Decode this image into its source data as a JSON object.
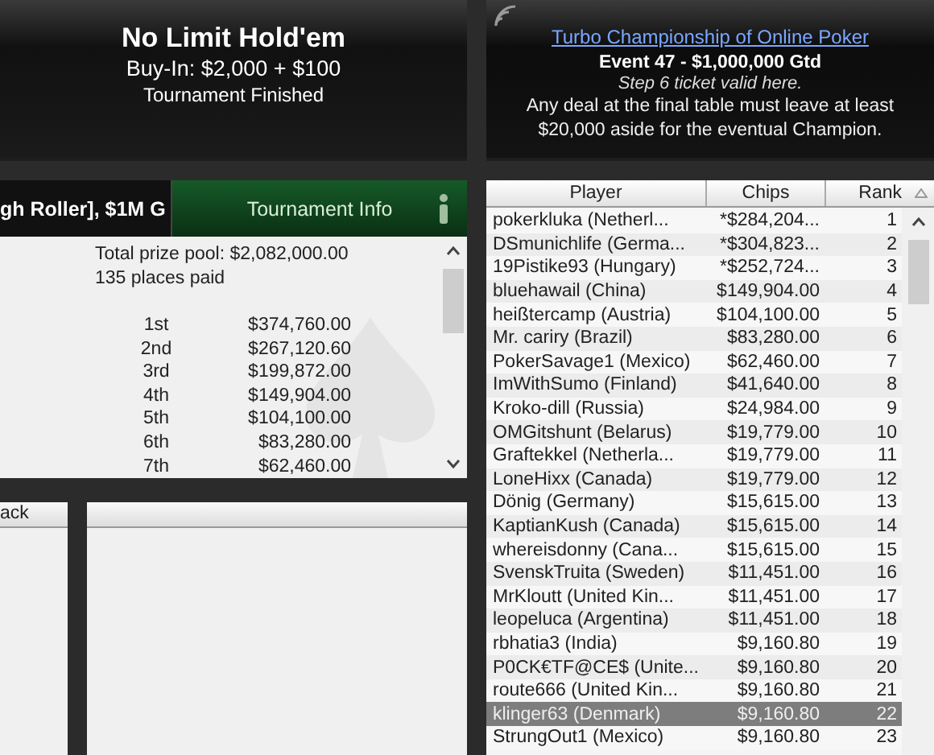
{
  "header": {
    "title": "No Limit Hold'em",
    "buy_in": "Buy-In: $2,000 + $100",
    "status": "Tournament Finished"
  },
  "event": {
    "link": "Turbo Championship of Online Poker",
    "subtitle": "Event 47 - $1,000,000 Gtd",
    "note": "Step 6 ticket valid here.",
    "message": "Any deal at the final table must leave at least $20,000 aside for the eventual Champion."
  },
  "tabs": [
    {
      "label": "gh Roller], $1M G",
      "selected": false
    },
    {
      "label": "Tournament Info",
      "selected": true
    }
  ],
  "prize": {
    "total": "Total prize pool: $2,082,000.00",
    "places": "135 places paid",
    "payouts": [
      {
        "place": "1st",
        "amount": "$374,760.00"
      },
      {
        "place": "2nd",
        "amount": "$267,120.60"
      },
      {
        "place": "3rd",
        "amount": "$199,872.00"
      },
      {
        "place": "4th",
        "amount": "$149,904.00"
      },
      {
        "place": "5th",
        "amount": "$104,100.00"
      },
      {
        "place": "6th",
        "amount": "$83,280.00"
      },
      {
        "place": "7th",
        "amount": "$62,460.00"
      }
    ]
  },
  "lower_left": {
    "header": "ack"
  },
  "players": {
    "columns": [
      "Player",
      "Chips",
      "Rank"
    ],
    "rows": [
      {
        "player": "pokerkluka (Netherl...",
        "chips": "*$284,204...",
        "rank": "1",
        "selected": false
      },
      {
        "player": "DSmunichlife (Germa...",
        "chips": "*$304,823...",
        "rank": "2",
        "selected": false
      },
      {
        "player": "19Pistike93 (Hungary)",
        "chips": "*$252,724...",
        "rank": "3",
        "selected": false
      },
      {
        "player": "bluehawail (China)",
        "chips": "$149,904.00",
        "rank": "4",
        "selected": false
      },
      {
        "player": "heißtercamp (Austria)",
        "chips": "$104,100.00",
        "rank": "5",
        "selected": false
      },
      {
        "player": "Mr. cariry (Brazil)",
        "chips": "$83,280.00",
        "rank": "6",
        "selected": false
      },
      {
        "player": "PokerSavage1 (Mexico)",
        "chips": "$62,460.00",
        "rank": "7",
        "selected": false
      },
      {
        "player": "ImWithSumo (Finland)",
        "chips": "$41,640.00",
        "rank": "8",
        "selected": false
      },
      {
        "player": "Kroko-dill (Russia)",
        "chips": "$24,984.00",
        "rank": "9",
        "selected": false
      },
      {
        "player": "OMGitshunt (Belarus)",
        "chips": "$19,779.00",
        "rank": "10",
        "selected": false
      },
      {
        "player": "Graftekkel (Netherla...",
        "chips": "$19,779.00",
        "rank": "11",
        "selected": false
      },
      {
        "player": "LoneHixx (Canada)",
        "chips": "$19,779.00",
        "rank": "12",
        "selected": false
      },
      {
        "player": "Dönig (Germany)",
        "chips": "$15,615.00",
        "rank": "13",
        "selected": false
      },
      {
        "player": "KaptianKush (Canada)",
        "chips": "$15,615.00",
        "rank": "14",
        "selected": false
      },
      {
        "player": "whereisdonny (Cana...",
        "chips": "$15,615.00",
        "rank": "15",
        "selected": false
      },
      {
        "player": "SvenskTruita (Sweden)",
        "chips": "$11,451.00",
        "rank": "16",
        "selected": false
      },
      {
        "player": "MrKloutt (United Kin...",
        "chips": "$11,451.00",
        "rank": "17",
        "selected": false
      },
      {
        "player": "leopeluca (Argentina)",
        "chips": "$11,451.00",
        "rank": "18",
        "selected": false
      },
      {
        "player": "rbhatia3 (India)",
        "chips": "$9,160.80",
        "rank": "19",
        "selected": false
      },
      {
        "player": "P0CK€TF@CE$ (Unite...",
        "chips": "$9,160.80",
        "rank": "20",
        "selected": false
      },
      {
        "player": "route666 (United Kin...",
        "chips": "$9,160.80",
        "rank": "21",
        "selected": false
      },
      {
        "player": "klinger63 (Denmark)",
        "chips": "$9,160.80",
        "rank": "22",
        "selected": true
      },
      {
        "player": "StrungOut1 (Mexico)",
        "chips": "$9,160.80",
        "rank": "23",
        "selected": false
      }
    ]
  }
}
